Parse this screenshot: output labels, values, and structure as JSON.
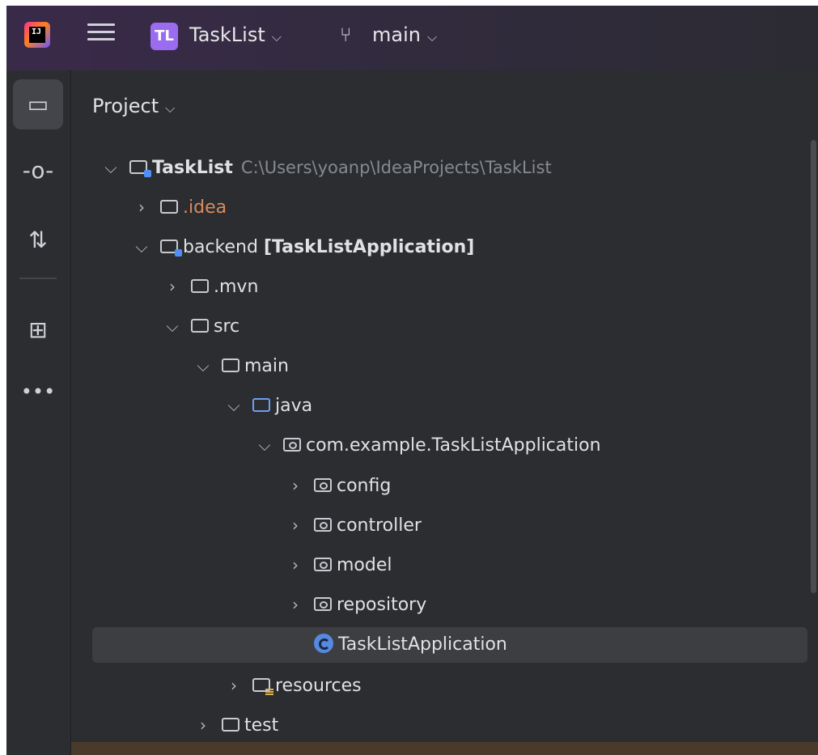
{
  "titlebar": {
    "project_badge": "TL",
    "project_name": "TaskList",
    "branch_name": "main"
  },
  "panel": {
    "title": "Project"
  },
  "tree": [
    {
      "label": "TaskList",
      "extra": "C:\\Users\\yoanp\\IdeaProjects\\TaskList"
    },
    {
      "label": ".idea"
    },
    {
      "label": "backend",
      "extra": "[TaskListApplication]"
    },
    {
      "label": ".mvn"
    },
    {
      "label": "src"
    },
    {
      "label": "main"
    },
    {
      "label": "java"
    },
    {
      "label": "com.example.TaskListApplication"
    },
    {
      "label": "config"
    },
    {
      "label": "controller"
    },
    {
      "label": "model"
    },
    {
      "label": "repository"
    },
    {
      "label": "TaskListApplication"
    },
    {
      "label": "resources"
    },
    {
      "label": "test"
    }
  ]
}
